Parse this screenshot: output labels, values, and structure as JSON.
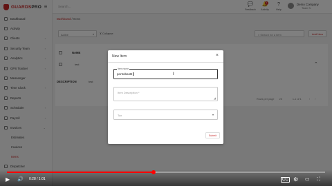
{
  "brand": {
    "name_red": "GUARDS",
    "name_dark": "PRO"
  },
  "sidebar": {
    "items": [
      {
        "label": "Dashboard",
        "chev": ""
      },
      {
        "label": "Activity",
        "chev": ""
      },
      {
        "label": "Clients",
        "chev": "›"
      },
      {
        "label": "Security Team",
        "chev": "›"
      },
      {
        "label": "Analytics",
        "chev": "›"
      },
      {
        "label": "GPS Tracker",
        "chev": "›"
      },
      {
        "label": "Messenger",
        "chev": ""
      },
      {
        "label": "Time Clock",
        "chev": "›"
      },
      {
        "label": "Reports",
        "chev": ""
      },
      {
        "label": "Scheduler",
        "chev": "›"
      },
      {
        "label": "Payroll",
        "chev": "›"
      },
      {
        "label": "Invoices",
        "chev": "⌄"
      }
    ],
    "subitems": [
      {
        "label": "Estimates",
        "active": false
      },
      {
        "label": "Invoices",
        "active": false
      },
      {
        "label": "Items",
        "active": true
      }
    ],
    "last_item": {
      "label": "Dispatcher"
    }
  },
  "topbar": {
    "search_placeholder": "Search...",
    "icons": [
      {
        "name": "feedback-icon",
        "label": "Feedback",
        "glyph": "💬"
      },
      {
        "name": "bell-icon",
        "label": "Activity",
        "glyph": "🔔",
        "badge": "1"
      },
      {
        "name": "help-icon",
        "label": "Help",
        "glyph": "?"
      }
    ],
    "user": {
      "name": "Demo Company",
      "role": "Team S."
    }
  },
  "page": {
    "breadcrumb": {
      "parent": "Dashboard",
      "current": "Items"
    },
    "filter_select": "Active",
    "collapse_label": "Collapse",
    "search_placeholder": "Search for a item",
    "add_label": "Add New",
    "table": {
      "headers": [
        "NAME",
        "DESCRIPTION"
      ],
      "row_values": [
        "test",
        "test"
      ]
    },
    "pager": {
      "rows_label": "Rows per page",
      "rows_value": "25",
      "range": "1-1 of 1"
    }
  },
  "modal": {
    "title": "New Item",
    "fields": {
      "item_name": {
        "label": "Item name",
        "value": "pontobanB"
      },
      "item_description": {
        "placeholder": "Item Description *"
      },
      "tax": {
        "placeholder": "Tax"
      }
    },
    "submit_label": "Submit"
  },
  "player": {
    "current_time": "0:28",
    "duration": "1:01",
    "time_display": "0:28 / 1:01",
    "played_fraction": 0.46,
    "buffered_fraction": 0.47,
    "icons": [
      "play-icon",
      "next-icon",
      "volume-icon",
      "captions-icon",
      "settings-icon",
      "miniplayer-icon",
      "theater-icon",
      "fullscreen-icon"
    ]
  }
}
